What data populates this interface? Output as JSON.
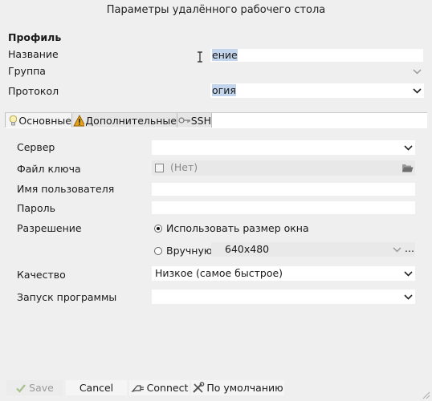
{
  "window": {
    "title": "Параметры удалённого рабочего стола"
  },
  "profile": {
    "heading": "Профиль",
    "name_label": "Название",
    "name_value": "ение",
    "group_label": "Группа",
    "group_value": "",
    "protocol_label": "Протокол",
    "protocol_value": "огия"
  },
  "tabs": [
    {
      "label": "Основные",
      "icon": "bulb-icon"
    },
    {
      "label": "Дополнительные",
      "icon": "warning-icon"
    },
    {
      "label": "SSH",
      "icon": "key-icon"
    }
  ],
  "form": {
    "server_label": "Сервер",
    "server_value": "",
    "keyfile_label": "Файл ключа",
    "keyfile_value": "(Нет)",
    "username_label": "Имя пользователя",
    "username_value": "",
    "password_label": "Пароль",
    "password_value": "",
    "resolution_label": "Разрешение",
    "resolution_option_window": "Использовать размер окна",
    "resolution_option_manual": "Вручную",
    "resolution_manual_value": "640x480",
    "resolution_more": "...",
    "quality_label": "Качество",
    "quality_value": "Низкое (самое быстрое)",
    "startup_label": "Запуск программы",
    "startup_value": ""
  },
  "buttons": {
    "save": "Save",
    "cancel": "Cancel",
    "connect": "Connect",
    "default": "По умолчанию"
  },
  "colors": {
    "background": "#efefef",
    "field": "#ffffff",
    "selection": "#c3d5ec",
    "warning": "#e8a21b"
  }
}
